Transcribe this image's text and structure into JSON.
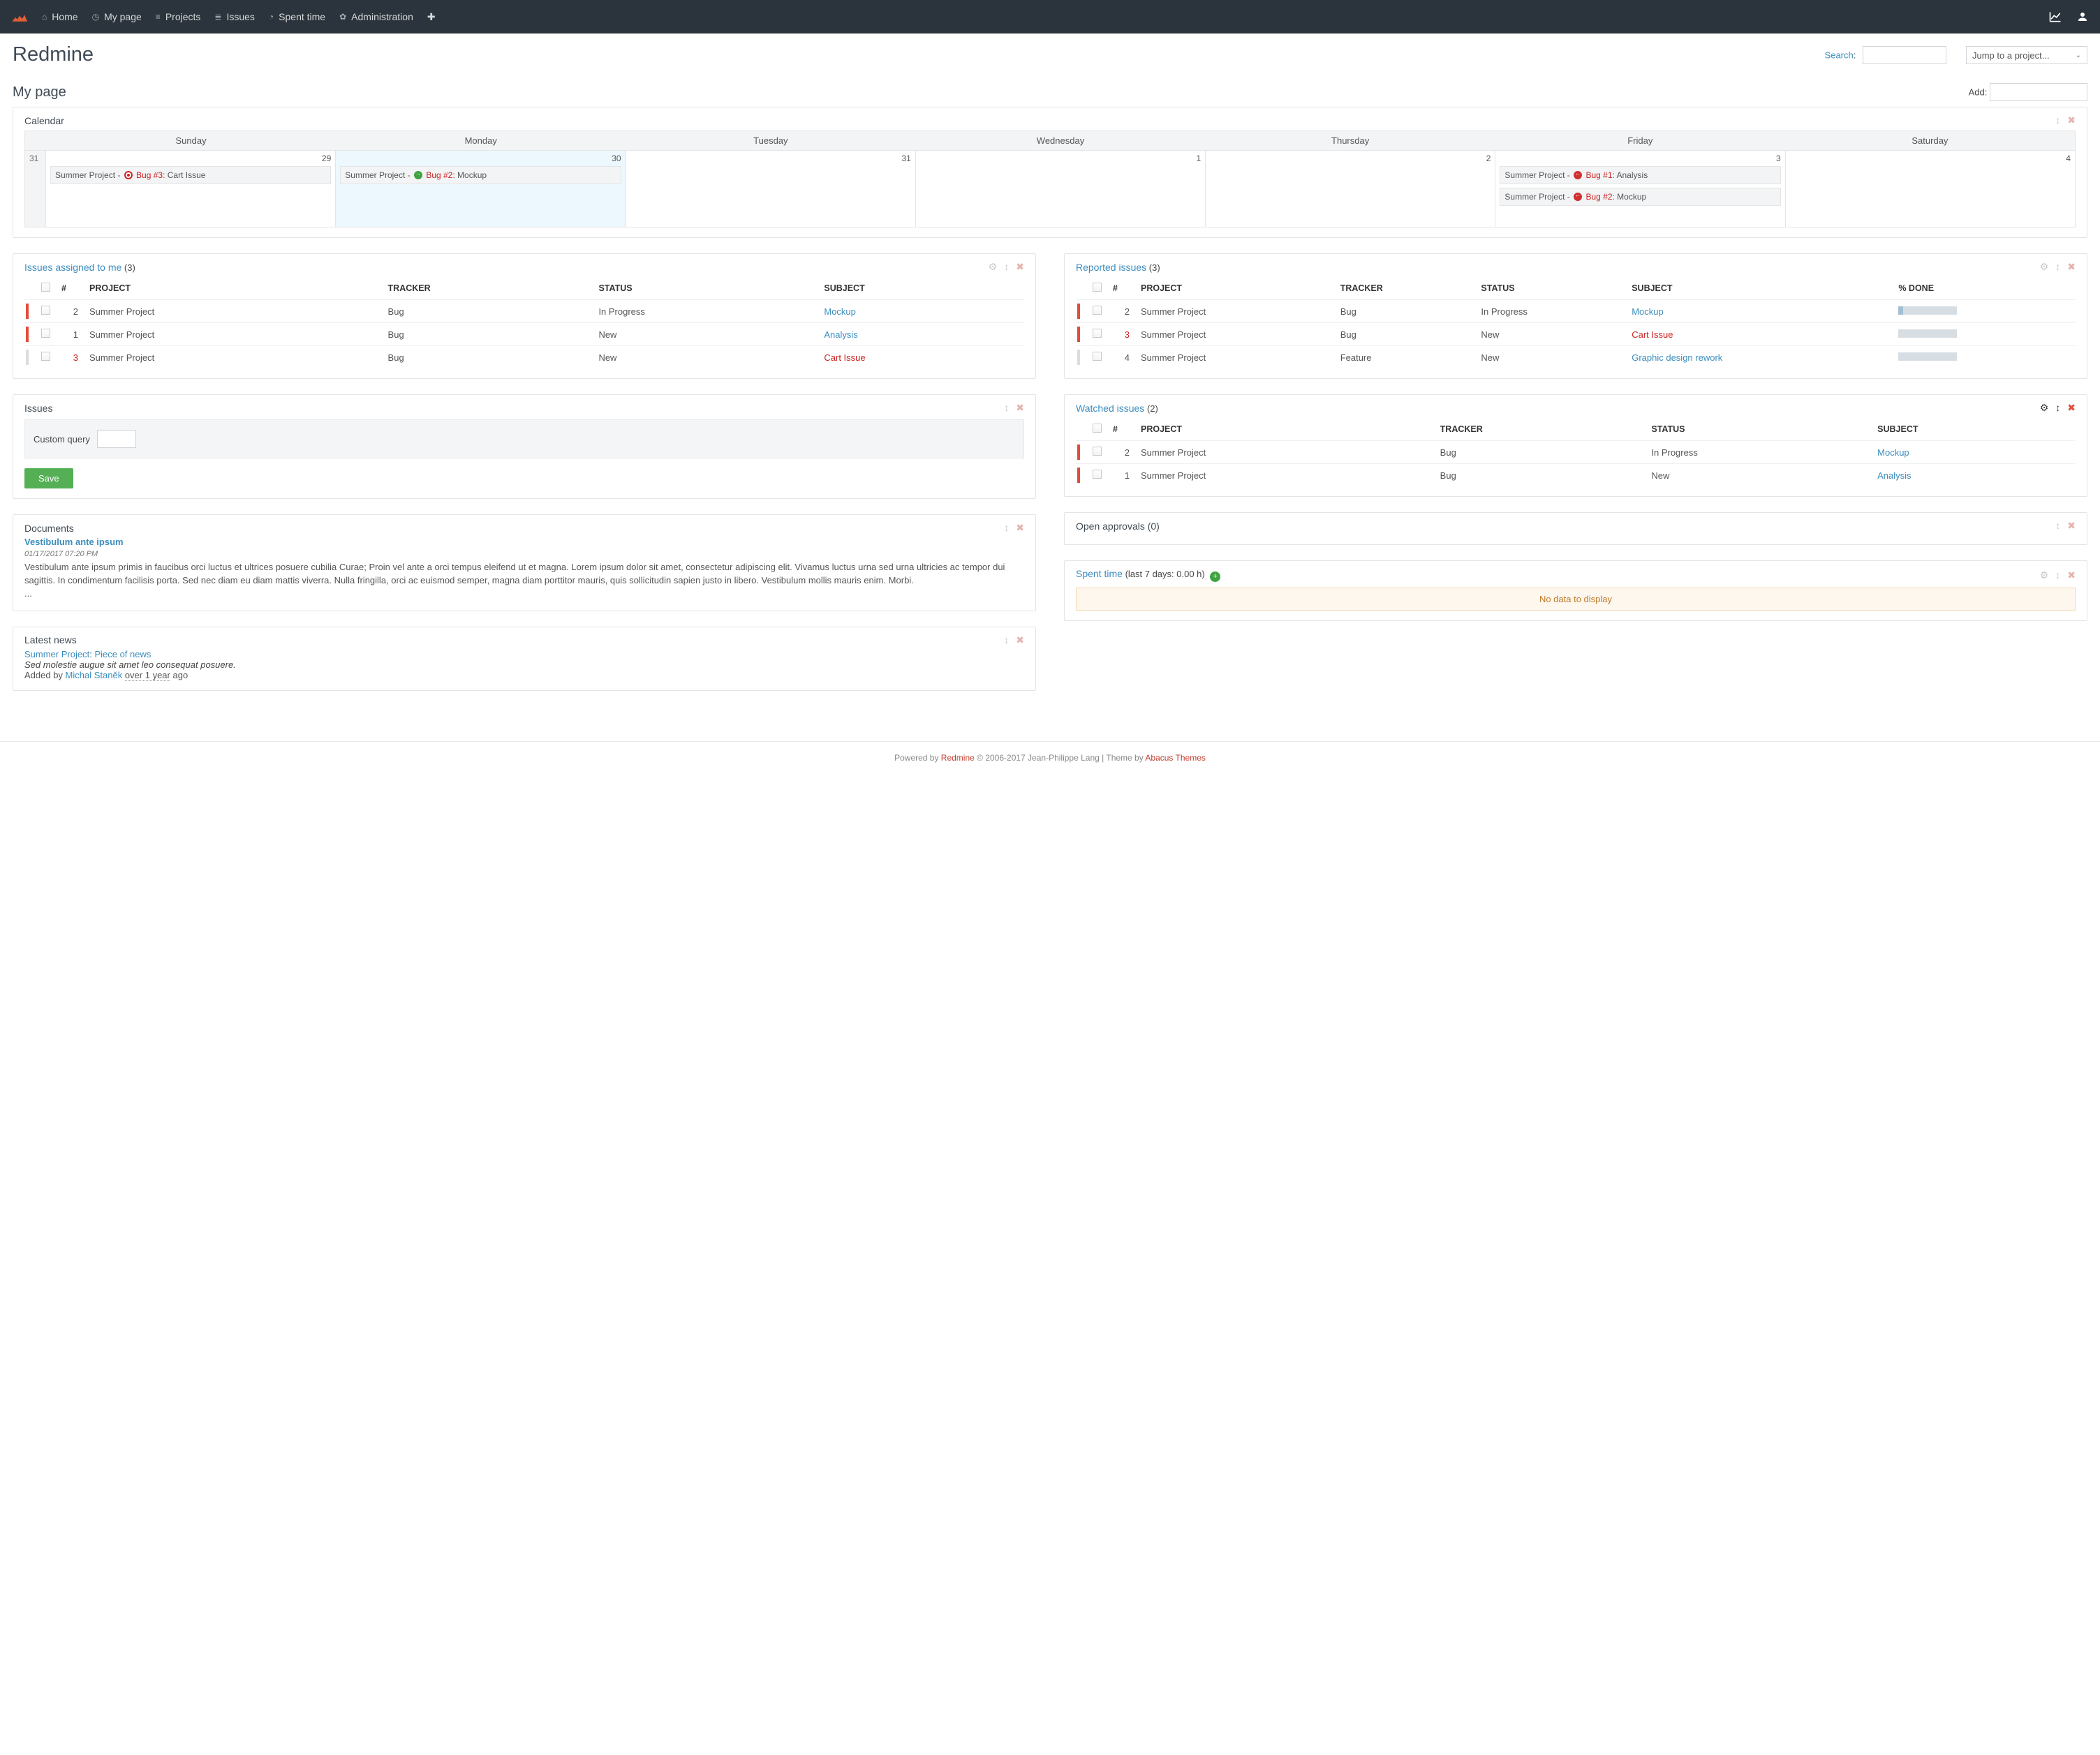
{
  "nav": {
    "items": [
      {
        "label": "Home",
        "icon": "home"
      },
      {
        "label": "My page",
        "icon": "dashboard"
      },
      {
        "label": "Projects",
        "icon": "list"
      },
      {
        "label": "Issues",
        "icon": "slist"
      },
      {
        "label": "Spent time",
        "icon": "clock"
      },
      {
        "label": "Administration",
        "icon": "gear"
      }
    ],
    "plus_icon": "+"
  },
  "app_title": "Redmine",
  "search": {
    "label": "Search",
    "colon": ":"
  },
  "project_jump": {
    "placeholder": "Jump to a project..."
  },
  "page_title": "My page",
  "add_label": "Add:",
  "calendar": {
    "title": "Calendar",
    "week_num": "31",
    "days": [
      "Sunday",
      "Monday",
      "Tuesday",
      "Wednesday",
      "Thursday",
      "Friday",
      "Saturday"
    ],
    "cells": [
      {
        "n": "29",
        "events": [
          {
            "proj": "Summer Project",
            "dot": "tgt",
            "issue": "Bug #3",
            "tail": ": Cart Issue",
            "cls": ""
          }
        ],
        "today": false
      },
      {
        "n": "30",
        "events": [
          {
            "proj": "Summer Project",
            "dot": "green",
            "issue": "Bug #2",
            "tail": ": Mockup",
            "cls": "red"
          }
        ],
        "today": true
      },
      {
        "n": "31",
        "events": [],
        "today": false
      },
      {
        "n": "1",
        "events": [],
        "today": false
      },
      {
        "n": "2",
        "events": [],
        "today": false
      },
      {
        "n": "3",
        "events": [
          {
            "proj": "Summer Project",
            "dot": "left",
            "issue": "Bug #1",
            "tail": ": Analysis",
            "cls": "red"
          },
          {
            "proj": "Summer Project",
            "dot": "left",
            "issue": "Bug #2",
            "tail": ": Mockup",
            "cls": "red"
          }
        ],
        "today": false
      },
      {
        "n": "4",
        "events": [],
        "today": false
      }
    ]
  },
  "assigned": {
    "title": "Issues assigned to me",
    "count": "(3)",
    "headers": [
      "#",
      "PROJECT",
      "TRACKER",
      "STATUS",
      "SUBJECT"
    ],
    "rows": [
      {
        "bar": "red",
        "n": "2",
        "proj": "Summer Project",
        "tracker": "Bug",
        "status": "In Progress",
        "subj": "Mockup",
        "red": false
      },
      {
        "bar": "red",
        "n": "1",
        "proj": "Summer Project",
        "tracker": "Bug",
        "status": "New",
        "subj": "Analysis",
        "red": false
      },
      {
        "bar": "",
        "n": "3",
        "proj": "Summer Project",
        "tracker": "Bug",
        "status": "New",
        "subj": "Cart Issue",
        "red": true,
        "nred": true
      }
    ]
  },
  "reported": {
    "title": "Reported issues",
    "count": "(3)",
    "headers": [
      "#",
      "PROJECT",
      "TRACKER",
      "STATUS",
      "SUBJECT",
      "% DONE"
    ],
    "rows": [
      {
        "bar": "red",
        "n": "2",
        "proj": "Summer Project",
        "tracker": "Bug",
        "status": "In Progress",
        "subj": "Mockup",
        "red": false,
        "done": 8
      },
      {
        "bar": "red",
        "n": "3",
        "proj": "Summer Project",
        "tracker": "Bug",
        "status": "New",
        "subj": "Cart Issue",
        "red": true,
        "nred": true,
        "done": 0
      },
      {
        "bar": "",
        "n": "4",
        "proj": "Summer Project",
        "tracker": "Feature",
        "status": "New",
        "subj": "Graphic design rework",
        "red": false,
        "done": 0
      }
    ]
  },
  "issues_box": {
    "title": "Issues",
    "query_label": "Custom query",
    "save": "Save"
  },
  "watched": {
    "title": "Watched issues",
    "count": "(2)",
    "headers": [
      "#",
      "PROJECT",
      "TRACKER",
      "STATUS",
      "SUBJECT"
    ],
    "rows": [
      {
        "bar": "red",
        "n": "2",
        "proj": "Summer Project",
        "tracker": "Bug",
        "status": "In Progress",
        "subj": "Mockup"
      },
      {
        "bar": "red",
        "n": "1",
        "proj": "Summer Project",
        "tracker": "Bug",
        "status": "New",
        "subj": "Analysis"
      }
    ]
  },
  "documents": {
    "title": "Documents",
    "doc_title": "Vestibulum ante ipsum",
    "date": "01/17/2017 07:20 PM",
    "body": "Vestibulum ante ipsum primis in faucibus orci luctus et ultrices posuere cubilia Curae; Proin vel ante a orci tempus eleifend ut et magna. Lorem ipsum dolor sit amet, consectetur adipiscing elit. Vivamus luctus urna sed urna ultricies ac tempor dui sagittis. In condimentum facilisis porta. Sed nec diam eu diam mattis viverra. Nulla fringilla, orci ac euismod semper, magna diam porttitor mauris, quis sollicitudin sapien justo in libero. Vestibulum mollis mauris enim. Morbi.",
    "ellipsis": "..."
  },
  "approvals": {
    "title": "Open approvals (0)"
  },
  "spent": {
    "title": "Spent time",
    "meta": "(last 7 days: 0.00 h)",
    "nodata": "No data to display"
  },
  "news": {
    "title": "Latest news",
    "proj": "Summer Project",
    "sep": ": ",
    "item": "Piece of news",
    "summary": "Sed molestie augue sit amet leo consequat posuere.",
    "added_by": "Added by ",
    "author": "Michal Staněk",
    "age": "over 1 year",
    "ago": " ago"
  },
  "footer": {
    "p1": "Powered by ",
    "redmine": "Redmine",
    "p2": " © 2006-2017 Jean-Philippe Lang | Theme by ",
    "theme": "Abacus Themes"
  }
}
